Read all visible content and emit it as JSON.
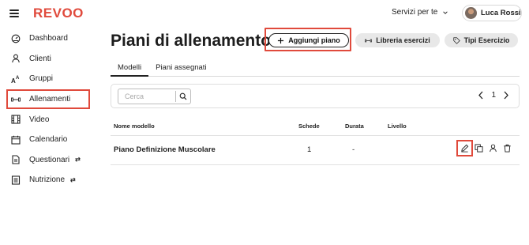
{
  "app": {
    "logo": "REVOO",
    "brand_color": "#e04a3c"
  },
  "topbar": {
    "services_label": "Servizi per te",
    "user_name": "Luca Rossi"
  },
  "sidebar": {
    "items": [
      {
        "label": "Dashboard",
        "icon": "dashboard-icon"
      },
      {
        "label": "Clienti",
        "icon": "user-icon"
      },
      {
        "label": "Gruppi",
        "icon": "group-icon"
      },
      {
        "label": "Allenamenti",
        "icon": "dumbbell-icon",
        "active": true
      },
      {
        "label": "Video",
        "icon": "film-icon"
      },
      {
        "label": "Calendario",
        "icon": "calendar-icon"
      },
      {
        "label": "Questionari",
        "icon": "document-icon",
        "tag": "⇄"
      },
      {
        "label": "Nutrizione",
        "icon": "notebook-icon",
        "tag": "⇄"
      }
    ]
  },
  "header": {
    "title": "Piani di allenamento",
    "add_label": "Aggiungi piano",
    "library_label": "Libreria esercizi",
    "types_label": "Tipi Esercizio"
  },
  "tabs": [
    {
      "label": "Modelli",
      "active": true
    },
    {
      "label": "Piani assegnati",
      "active": false
    }
  ],
  "toolbar": {
    "search_placeholder": "Cerca",
    "search_value": "",
    "page": "1"
  },
  "table": {
    "columns": [
      "Nome modello",
      "Schede",
      "Durata",
      "Livello"
    ],
    "rows": [
      {
        "name": "Piano Definizione Muscolare",
        "schede": "1",
        "durata": "-",
        "livello": ""
      }
    ]
  }
}
